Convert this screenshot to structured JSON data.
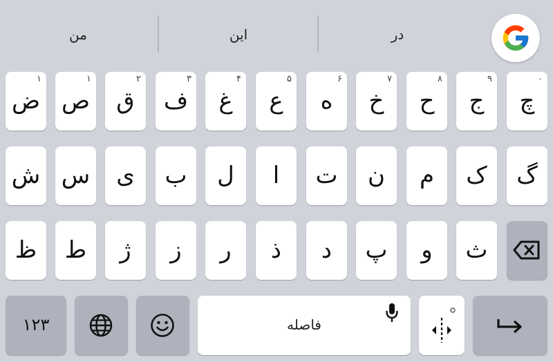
{
  "suggestions": [
    "در",
    "این",
    "من"
  ],
  "row1": [
    {
      "char": "چ",
      "hint": "۰"
    },
    {
      "char": "ج",
      "hint": "۹"
    },
    {
      "char": "ح",
      "hint": "۸"
    },
    {
      "char": "خ",
      "hint": "۷"
    },
    {
      "char": "ه",
      "hint": "۶"
    },
    {
      "char": "ع",
      "hint": "۵"
    },
    {
      "char": "غ",
      "hint": "۴"
    },
    {
      "char": "ف",
      "hint": "۳"
    },
    {
      "char": "ق",
      "hint": "۲"
    },
    {
      "char": "ص",
      "hint": "۱"
    },
    {
      "char": "ض",
      "hint": "۱"
    }
  ],
  "row2": [
    "گ",
    "ک",
    "م",
    "ن",
    "ت",
    "ا",
    "ل",
    "ب",
    "ی",
    "س",
    "ش"
  ],
  "row3": [
    "ث",
    "و",
    "پ",
    "د",
    "ذ",
    "ر",
    "ز",
    "ژ",
    "ط",
    "ظ"
  ],
  "bottom": {
    "numbers_label": "۱۲۳",
    "space_label": "فاصله"
  },
  "icons": {
    "google": "google-g-icon",
    "backspace": "backspace-icon",
    "globe": "globe-icon",
    "emoji": "emoji-icon",
    "mic": "mic-icon",
    "cursor": "cursor-move-icon",
    "enter": "enter-icon"
  }
}
